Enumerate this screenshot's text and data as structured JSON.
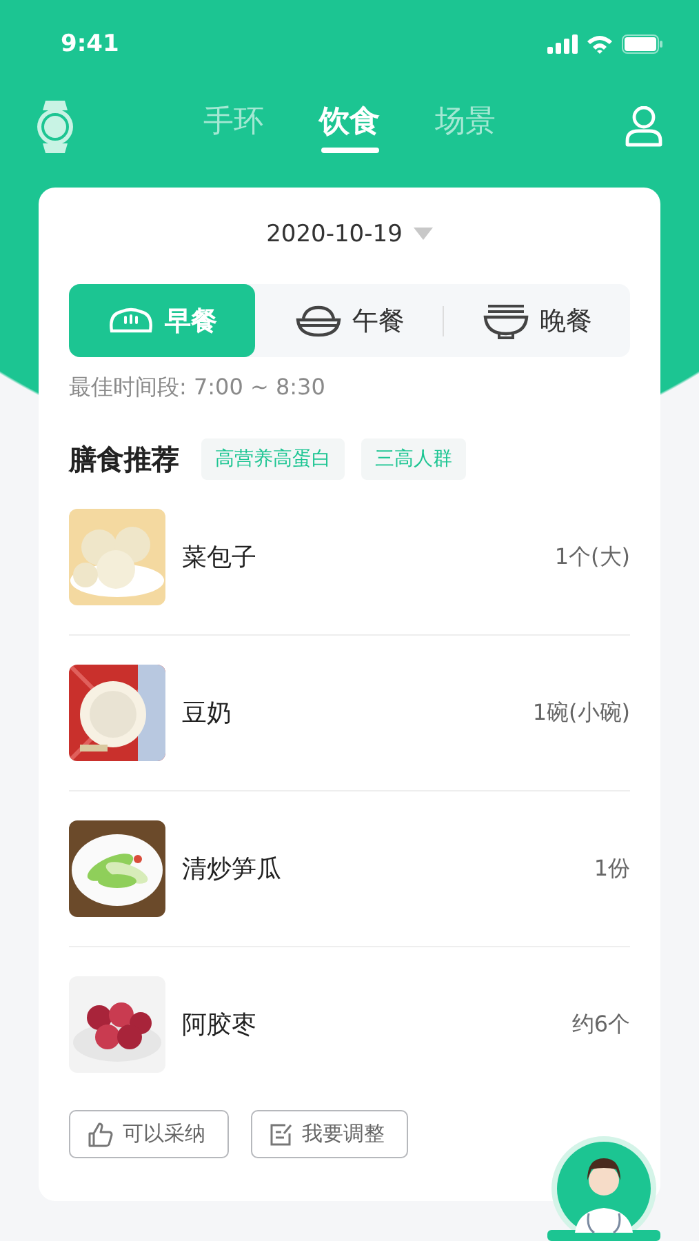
{
  "status_bar": {
    "time": "9:41"
  },
  "nav": {
    "tabs": [
      {
        "label": "手环",
        "selected": false
      },
      {
        "label": "饮食",
        "selected": true
      },
      {
        "label": "场景",
        "selected": false
      }
    ]
  },
  "date_picker": {
    "value": "2020-10-19"
  },
  "meals": [
    {
      "label": "早餐",
      "kind": "bread",
      "selected": true
    },
    {
      "label": "午餐",
      "kind": "rice",
      "selected": false
    },
    {
      "label": "晚餐",
      "kind": "noodle",
      "selected": false
    }
  ],
  "best_time": "最佳时间段: 7:00 ~ 8:30",
  "recommendation": {
    "title": "膳食推荐",
    "tags": [
      "高营养高蛋白",
      "三高人群"
    ]
  },
  "foods": [
    {
      "name": "菜包子",
      "amount": "1个(大)"
    },
    {
      "name": "豆奶",
      "amount": "1碗(小碗)"
    },
    {
      "name": "清炒笋瓜",
      "amount": "1份"
    },
    {
      "name": "阿胶枣",
      "amount": "约6个"
    }
  ],
  "actions": [
    {
      "label": "可以采纳",
      "kind": "like"
    },
    {
      "label": "我要调整",
      "kind": "edit"
    }
  ]
}
